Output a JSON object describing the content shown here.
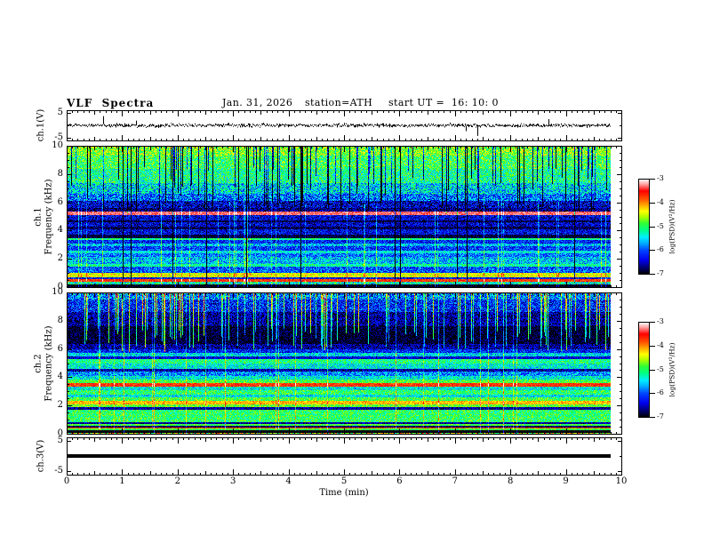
{
  "chart_data": {
    "type": "heatmap",
    "subtype": "vlf-multipanel-spectrogram",
    "title": "VLF  Spectra",
    "date": "Jan. 31, 2026",
    "station": "station=ATH",
    "start_ut": "start UT =  16: 10: 0",
    "xlabel": "Time  (min)",
    "xlim": [
      0,
      10
    ],
    "x_ticks": [
      "0",
      "1",
      "2",
      "3",
      "4",
      "5",
      "6",
      "7",
      "8",
      "9",
      "10"
    ],
    "x_tick_values": [
      0,
      1,
      2,
      3,
      4,
      5,
      6,
      7,
      8,
      9,
      10
    ],
    "data_end_min": 9.8,
    "colormap": {
      "label": "log(PSD)(V²/Hz)",
      "tick_labels": [
        "-3",
        "-4",
        "-5",
        "-6",
        "-7"
      ],
      "tick_values": [
        -3,
        -4,
        -5,
        -6,
        -7
      ],
      "range": [
        -7,
        -3
      ],
      "stops": [
        [
          -7,
          "#000000"
        ],
        [
          -6.75,
          "#000066"
        ],
        [
          -6.4,
          "#0000ee"
        ],
        [
          -6.0,
          "#0044ff"
        ],
        [
          -5.7,
          "#00aaff"
        ],
        [
          -5.45,
          "#00eeff"
        ],
        [
          -5.15,
          "#00ff88"
        ],
        [
          -4.85,
          "#33ff33"
        ],
        [
          -4.6,
          "#aaff00"
        ],
        [
          -4.35,
          "#ffff00"
        ],
        [
          -4.1,
          "#ffaa00"
        ],
        [
          -3.85,
          "#ff5500"
        ],
        [
          -3.5,
          "#ff0000"
        ],
        [
          -3.2,
          "#ffaaaa"
        ],
        [
          -3,
          "#ffffff"
        ]
      ]
    },
    "panels": [
      {
        "id": "ch1-wave",
        "type": "waveform",
        "ylabel": "ch.1(V)",
        "ylim": [
          -6.1,
          6.1
        ],
        "y_tick_labels": [
          "5",
          "-5"
        ],
        "y_tick_values": [
          5,
          -5
        ],
        "noise_amp": 0.8,
        "spike_prob": 0.02,
        "spike_base": 1.5,
        "spike_extra": 4.0,
        "seed": 1234
      },
      {
        "id": "ch1-spec",
        "type": "spectrogram",
        "ylabel_line1": "ch.1",
        "ylabel_line2": "Frequency  (kHz)",
        "ylim": [
          0,
          10
        ],
        "y_tick_labels": [
          "0",
          "2",
          "4",
          "6",
          "8",
          "10"
        ],
        "y_tick_values": [
          0,
          2,
          4,
          6,
          8,
          10
        ],
        "seed": 77,
        "bands": [
          [
            0,
            0.25,
            -6.95,
            0.25
          ],
          [
            0.25,
            0.45,
            -5.3,
            0.7
          ],
          [
            0.45,
            0.62,
            -3.7,
            0.3
          ],
          [
            0.62,
            0.78,
            -6.3,
            0.5
          ],
          [
            0.78,
            1.05,
            -4.4,
            0.4
          ],
          [
            1.05,
            1.5,
            -6.0,
            0.55
          ],
          [
            1.5,
            1.68,
            -5.2,
            0.4
          ],
          [
            1.68,
            2.2,
            -5.6,
            0.55
          ],
          [
            2.2,
            2.45,
            -5.9,
            0.5
          ],
          [
            2.45,
            2.6,
            -5.4,
            0.4
          ],
          [
            2.6,
            2.95,
            -6.1,
            0.5
          ],
          [
            2.95,
            3.15,
            -5.6,
            0.5
          ],
          [
            3.15,
            3.35,
            -6.2,
            0.5
          ],
          [
            3.35,
            3.5,
            -5.1,
            0.35
          ],
          [
            3.5,
            3.75,
            -6.85,
            0.25
          ],
          [
            3.75,
            4.15,
            -6.35,
            0.5
          ],
          [
            4.15,
            4.3,
            -6.8,
            0.3
          ],
          [
            4.3,
            4.6,
            -6.45,
            0.5
          ],
          [
            4.6,
            4.75,
            -6.85,
            0.25
          ],
          [
            4.75,
            5.15,
            -6.4,
            0.5
          ],
          [
            5.15,
            5.35,
            -3.3,
            0.15
          ],
          [
            5.35,
            5.65,
            -6.7,
            0.4
          ],
          [
            5.65,
            6.1,
            -6.45,
            0.6
          ],
          [
            6.1,
            6.6,
            -5.9,
            0.7
          ],
          [
            6.6,
            7.4,
            -5.5,
            0.7
          ],
          [
            7.4,
            8.4,
            -5.15,
            0.6
          ],
          [
            8.4,
            9.3,
            -4.95,
            0.55
          ],
          [
            9.3,
            10,
            -4.7,
            0.55
          ]
        ],
        "streaks": [
          {
            "prob": 0.16,
            "sign": -1,
            "strength": [
              1.0,
              2.6
            ],
            "dir": "above",
            "edge": [
              5.2,
              8.5
            ]
          },
          {
            "prob": 0.025,
            "sign": -1,
            "strength": [
              1.5,
              3.0
            ],
            "dir": "above",
            "edge": [
              0,
              0.5
            ]
          },
          {
            "prob": 0.05,
            "sign": 1,
            "strength": [
              0.4,
              0.9
            ],
            "dir": "below",
            "edge": [
              5.2,
              6.5
            ]
          }
        ]
      },
      {
        "id": "ch2-spec",
        "type": "spectrogram",
        "ylabel_line1": "ch.2",
        "ylabel_line2": "Frequency  (kHz)",
        "ylim": [
          0,
          10
        ],
        "y_tick_labels": [
          "0",
          "2",
          "4",
          "6",
          "8",
          "10"
        ],
        "y_tick_values": [
          0,
          2,
          4,
          6,
          8,
          10
        ],
        "seed": 991,
        "bands": [
          [
            0,
            0.1,
            -4.5,
            0.9
          ],
          [
            0.1,
            0.32,
            -7,
            0.15
          ],
          [
            0.32,
            0.42,
            -4.9,
            0.3
          ],
          [
            0.42,
            0.52,
            -3.8,
            0.25
          ],
          [
            0.52,
            0.64,
            -6.8,
            0.3
          ],
          [
            0.64,
            0.78,
            -4.9,
            0.35
          ],
          [
            0.78,
            0.9,
            -6.6,
            0.35
          ],
          [
            0.9,
            1.75,
            -5.0,
            0.45
          ],
          [
            1.75,
            1.95,
            -6.6,
            0.3
          ],
          [
            1.95,
            2.1,
            -4.8,
            0.35
          ],
          [
            2.1,
            2.4,
            -4.15,
            0.3
          ],
          [
            2.4,
            2.6,
            -4.9,
            0.4
          ],
          [
            2.6,
            2.8,
            -5.5,
            0.45
          ],
          [
            2.8,
            3.1,
            -5.0,
            0.45
          ],
          [
            3.1,
            3.35,
            -5.4,
            0.5
          ],
          [
            3.35,
            3.6,
            -3.7,
            0.3
          ],
          [
            3.6,
            3.85,
            -4.9,
            0.4
          ],
          [
            3.85,
            4.1,
            -5.4,
            0.5
          ],
          [
            4.1,
            4.45,
            -5.8,
            0.55
          ],
          [
            4.45,
            4.6,
            -6.6,
            0.35
          ],
          [
            4.6,
            5.0,
            -5.4,
            0.5
          ],
          [
            5.0,
            5.3,
            -5.1,
            0.45
          ],
          [
            5.3,
            5.5,
            -6.4,
            0.4
          ],
          [
            5.5,
            5.75,
            -5.5,
            0.5
          ],
          [
            5.75,
            6.0,
            -6.2,
            0.5
          ],
          [
            6.0,
            6.4,
            -6.6,
            0.45
          ],
          [
            6.4,
            7.6,
            -6.9,
            0.35
          ],
          [
            7.6,
            8.6,
            -6.6,
            0.5
          ],
          [
            8.6,
            9.5,
            -6.2,
            0.6
          ],
          [
            9.5,
            10,
            -5.8,
            0.7
          ]
        ],
        "streaks": [
          {
            "prob": 0.18,
            "sign": 1,
            "strength": [
              0.9,
              2.2
            ],
            "dir": "above",
            "edge": [
              5.8,
              7.5
            ]
          },
          {
            "prob": 0.03,
            "sign": 1,
            "strength": [
              0.4,
              0.9
            ],
            "dir": "above",
            "edge": [
              0,
              0.5
            ]
          }
        ]
      },
      {
        "id": "ch3-wave",
        "type": "flatline",
        "ylabel": "ch.3(V)",
        "ylim": [
          -6.1,
          6.1
        ],
        "y_tick_labels": [
          "5",
          "-5"
        ],
        "y_tick_values": [
          5,
          -5
        ],
        "line_value": 0,
        "line_thickness": 4
      }
    ]
  }
}
